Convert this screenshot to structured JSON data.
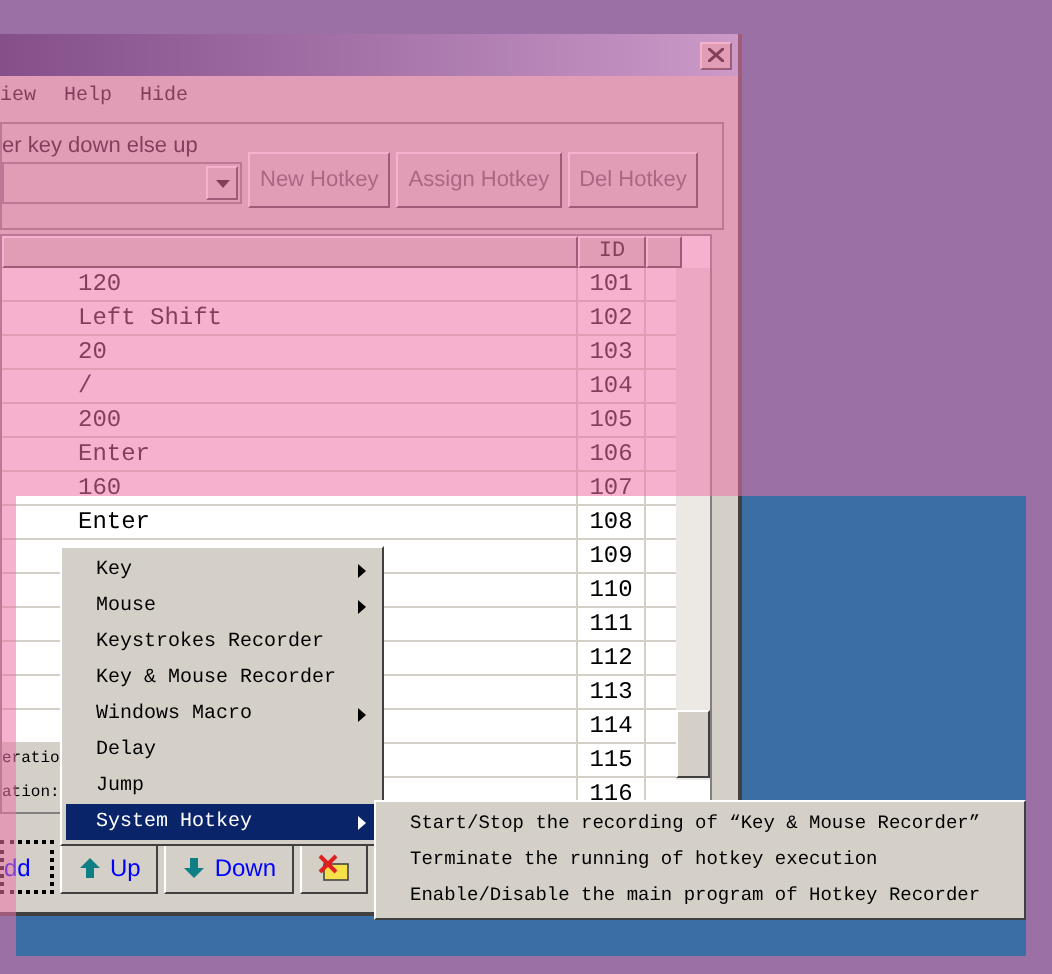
{
  "window": {
    "menu": [
      "iew",
      "Help",
      "Hide"
    ],
    "hint": "er key down else up",
    "buttons": [
      {
        "label": "New Hotkey",
        "disabled": true
      },
      {
        "label": "Assign Hotkey",
        "disabled": true
      },
      {
        "label": "Del Hotkey",
        "disabled": true
      }
    ]
  },
  "table": {
    "columns": [
      "ID"
    ],
    "rows": [
      {
        "value": "120",
        "id": "101"
      },
      {
        "value": "Left Shift",
        "id": "102"
      },
      {
        "value": "20",
        "id": "103"
      },
      {
        "value": "/",
        "id": "104"
      },
      {
        "value": "200",
        "id": "105"
      },
      {
        "value": "Enter",
        "id": "106"
      },
      {
        "value": "160",
        "id": "107"
      },
      {
        "value": "Enter",
        "id": "108"
      },
      {
        "id": "109"
      },
      {
        "id": "110"
      },
      {
        "id": "111"
      },
      {
        "id": "112"
      },
      {
        "id": "113"
      },
      {
        "id": "114"
      },
      {
        "id": "115",
        "left_text": "eratio"
      },
      {
        "id": "116",
        "left_text": "ation:"
      }
    ]
  },
  "bottom_buttons": [
    {
      "label": "dd",
      "kind": "text",
      "focused": true
    },
    {
      "label": "Up",
      "kind": "up",
      "focused": false
    },
    {
      "label": "Down",
      "kind": "down",
      "focused": false
    },
    {
      "kind": "delete",
      "focused": false
    }
  ],
  "context_menu": [
    {
      "label": "Key",
      "has_submenu": true,
      "selected": false
    },
    {
      "label": "Mouse",
      "has_submenu": true,
      "selected": false
    },
    {
      "label": "Keystrokes Recorder",
      "has_submenu": false,
      "selected": false
    },
    {
      "label": "Key & Mouse Recorder",
      "has_submenu": false,
      "selected": false
    },
    {
      "label": "Windows Macro",
      "has_submenu": true,
      "selected": false
    },
    {
      "label": "Delay",
      "has_submenu": false,
      "selected": false
    },
    {
      "label": "Jump",
      "has_submenu": false,
      "selected": false
    },
    {
      "label": "System Hotkey",
      "has_submenu": true,
      "selected": true
    }
  ],
  "submenu": [
    "Start/Stop the recording of “Key & Mouse Recorder”",
    "Terminate the running of hotkey execution",
    "Enable/Disable the main program of Hotkey Recorder"
  ]
}
